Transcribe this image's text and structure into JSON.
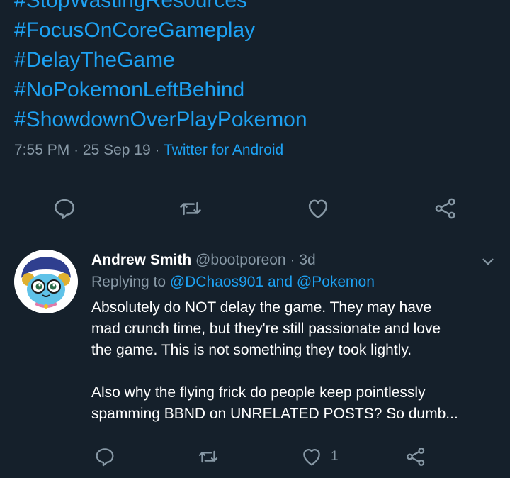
{
  "top_tweet": {
    "hashtags": [
      "#StopWastingResources",
      "#FocusOnCoreGameplay",
      "#DelayTheGame",
      "#NoPokemonLeftBehind",
      "#ShowdownOverPlayPokemon"
    ],
    "time": "7:55 PM",
    "date": "25 Sep 19",
    "separator": "·",
    "source": "Twitter for Android",
    "actions": {
      "reply": "reply-icon",
      "retweet": "retweet-icon",
      "like": "heart-icon",
      "share": "share-icon"
    }
  },
  "reply_tweet": {
    "author_name": "Andrew Smith",
    "author_handle": "@bootporeon",
    "separator": "·",
    "age": "3d",
    "replying_label": "Replying to",
    "replying_mention_1": "@DChaos901",
    "replying_conjunction": "and",
    "replying_mention_2": "@Pokemon",
    "body_lines": [
      "Absolutely do NOT delay the game. They may have",
      "mad crunch time, but they're still passionate and love",
      "the game. This is not something they took lightly.",
      "",
      "Also why the flying frick do people keep pointlessly",
      "spamming BBND on UNRELATED POSTS? So dumb..."
    ],
    "like_count": "1"
  },
  "colors": {
    "background": "#15202b",
    "accent": "#1da1f2",
    "muted": "#8899a6",
    "divider": "#38444d"
  }
}
